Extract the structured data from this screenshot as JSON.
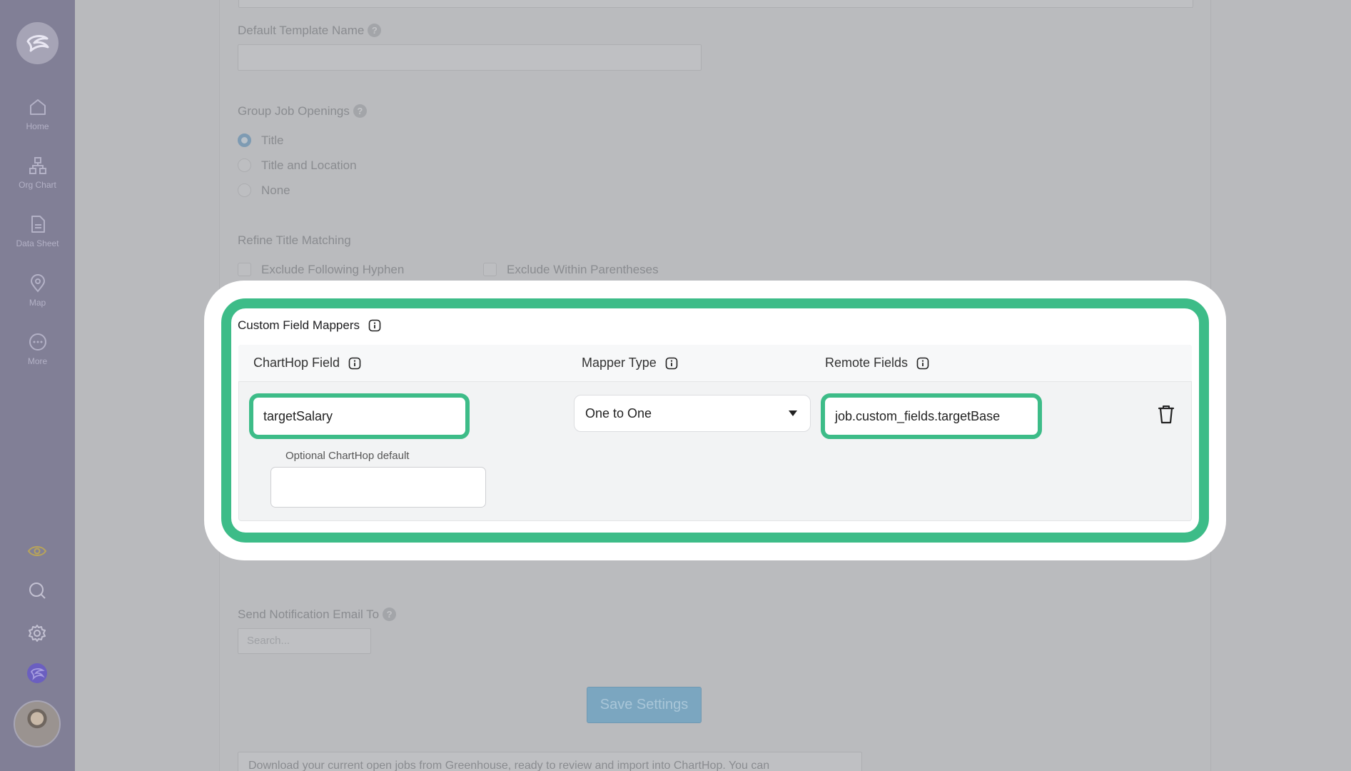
{
  "sidebar": {
    "items": [
      {
        "label": "Home",
        "icon": "home-icon"
      },
      {
        "label": "Org Chart",
        "icon": "org-chart-icon"
      },
      {
        "label": "Data Sheet",
        "icon": "document-icon"
      },
      {
        "label": "Map",
        "icon": "map-pin-icon"
      },
      {
        "label": "More",
        "icon": "more-icon"
      }
    ],
    "bottom_icons": [
      "eye-icon",
      "search-icon",
      "gear-icon",
      "app-logo-icon"
    ]
  },
  "settings": {
    "default_template_name": {
      "label": "Default Template Name",
      "help": "?",
      "value": ""
    },
    "group_job_openings": {
      "label": "Group Job Openings",
      "help": "?",
      "options": [
        "Title",
        "Title and Location",
        "None"
      ],
      "selected": "Title"
    },
    "refine_title_matching": {
      "label": "Refine Title Matching",
      "options": [
        "Exclude Following Hyphen",
        "Exclude Within Parentheses"
      ]
    },
    "notification_email": {
      "label": "Send Notification Email To",
      "help": "?",
      "placeholder": "Search..."
    },
    "save_label": "Save Settings",
    "footer_text": "Download your current open jobs from Greenhouse, ready to review and import into ChartHop. You can"
  },
  "custom_field_mappers": {
    "title": "Custom Field Mappers",
    "columns": [
      "ChartHop Field",
      "Mapper Type",
      "Remote Fields"
    ],
    "rows": [
      {
        "charthop_field": "targetSalary",
        "mapper_type": "One to One",
        "remote_fields": "job.custom_fields.targetBase",
        "default_label": "Optional ChartHop default",
        "default_value": ""
      }
    ]
  },
  "colors": {
    "highlight": "#3dbc88",
    "sidebar": "#817f96",
    "save_button": "#7ba6c0"
  }
}
